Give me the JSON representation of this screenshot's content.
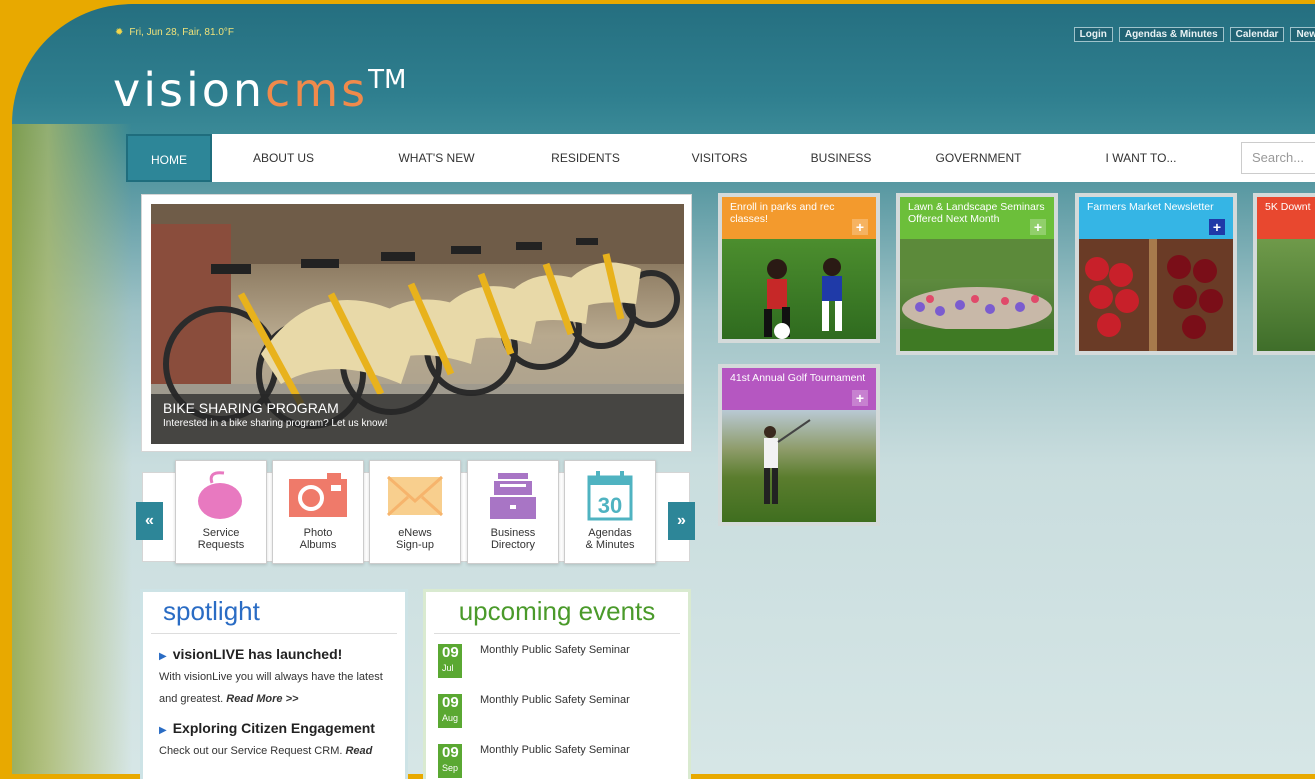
{
  "topbar": {
    "weather": "Fri, Jun 28, Fair, 81.0°F",
    "links": [
      "Login",
      "Agendas & Minutes",
      "Calendar",
      "New"
    ]
  },
  "logo": {
    "vision": "vision",
    "cms": "cms",
    "tm": "TM"
  },
  "nav": {
    "items": [
      "HOME",
      "ABOUT US",
      "WHAT'S NEW",
      "RESIDENTS",
      "VISITORS",
      "BUSINESS",
      "GOVERNMENT",
      "I WANT TO..."
    ],
    "search_placeholder": "Search..."
  },
  "hero": {
    "title": "BIKE SHARING PROGRAM",
    "subtitle": "Interested in a bike sharing program? Let us know!"
  },
  "quicklinks": {
    "prev": "«",
    "next": "»",
    "items": [
      {
        "label": "Service\nRequests",
        "icon": "mouse-icon",
        "color": "#e879c0"
      },
      {
        "label": "Photo\nAlbums",
        "icon": "camera-icon",
        "color": "#ef7a6a"
      },
      {
        "label": "eNews\nSign-up",
        "icon": "envelope-icon",
        "color": "#f6b46c"
      },
      {
        "label": "Business\nDirectory",
        "icon": "building-icon",
        "color": "#a875c5"
      },
      {
        "label": "Agendas\n& Minutes",
        "icon": "calendar-icon",
        "color": "#4fb3c1"
      }
    ],
    "calendar_number": "30"
  },
  "tiles": [
    {
      "title": "Enroll in parks and rec classes!",
      "color": "#f39a2d"
    },
    {
      "title": "Lawn & Landscape Seminars Offered Next Month",
      "color": "#6cbf3a"
    },
    {
      "title": "Farmers Market Newsletter",
      "color": "#35b5e5"
    },
    {
      "title": "5K Downt",
      "color": "#e8482f"
    },
    {
      "title": "41st Annual Golf Tournament",
      "color": "#b557c1"
    }
  ],
  "tile_plus": "+",
  "spotlight": {
    "heading": "spotlight",
    "items": [
      {
        "title": "visionLIVE has launched!",
        "body": "With visionLive you will always have the latest and greatest.",
        "more": "Read More >>"
      },
      {
        "title": "Exploring Citizen Engagement",
        "body": "Check out our Service Request CRM.",
        "more": "Read"
      }
    ]
  },
  "events": {
    "heading": "upcoming events",
    "items": [
      {
        "day": "09",
        "month": "Jul",
        "title": "Monthly Public Safety Seminar"
      },
      {
        "day": "09",
        "month": "Aug",
        "title": "Monthly Public Safety Seminar"
      },
      {
        "day": "09",
        "month": "Sep",
        "title": "Monthly Public Safety Seminar"
      }
    ]
  }
}
